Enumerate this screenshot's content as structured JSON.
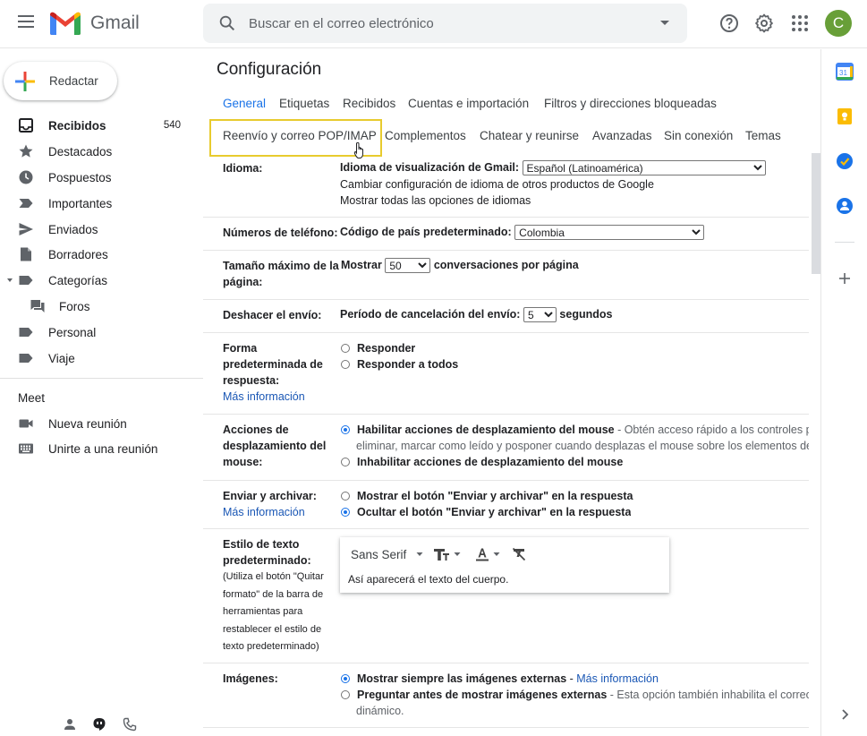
{
  "header": {
    "app_name": "Gmail",
    "search_placeholder": "Buscar en el correo electrónico",
    "avatar_letter": "C"
  },
  "sidebar": {
    "compose_label": "Redactar",
    "items": [
      {
        "label": "Recibidos",
        "count": "540",
        "icon": "inbox-icon"
      },
      {
        "label": "Destacados",
        "icon": "star-icon"
      },
      {
        "label": "Pospuestos",
        "icon": "clock-icon"
      },
      {
        "label": "Importantes",
        "icon": "label-important-icon"
      },
      {
        "label": "Enviados",
        "icon": "send-icon"
      },
      {
        "label": "Borradores",
        "icon": "draft-icon"
      },
      {
        "label": "Categorías",
        "icon": "label-icon"
      },
      {
        "label": "Foros",
        "icon": "forum-icon"
      },
      {
        "label": "Personal",
        "icon": "label-icon"
      },
      {
        "label": "Viaje",
        "icon": "label-icon"
      }
    ],
    "meet_title": "Meet",
    "meet_items": [
      {
        "label": "Nueva reunión",
        "icon": "video-icon"
      },
      {
        "label": "Unirte a una reunión",
        "icon": "keyboard-icon"
      }
    ]
  },
  "main": {
    "title": "Configuración",
    "tabs_row1": [
      "General",
      "Etiquetas",
      "Recibidos",
      "Cuentas e importación",
      "Filtros y direcciones bloqueadas"
    ],
    "tabs_row2": [
      "Reenvío y correo POP/IMAP",
      "Complementos",
      "Chatear y reunirse",
      "Avanzadas",
      "Sin conexión",
      "Temas"
    ],
    "settings": {
      "idioma": {
        "label": "Idioma:",
        "display_label": "Idioma de visualización de Gmail:",
        "display_value": "Español (Latinoamérica)",
        "link1": "Cambiar configuración de idioma de otros productos de Google",
        "link2": "Mostrar todas las opciones de idiomas"
      },
      "telefono": {
        "label": "Números de teléfono:",
        "code_label": "Código de país predeterminado:",
        "code_value": "Colombia"
      },
      "tamano": {
        "label_line1": "Tamaño máximo de la",
        "label_line2": "página:",
        "prefix": "Mostrar",
        "value": "50",
        "suffix": "conversaciones por página"
      },
      "deshacer": {
        "label": "Deshacer el envío:",
        "prefix": "Período de cancelación del envío:",
        "value": "5",
        "suffix": "segundos"
      },
      "respuesta": {
        "label_line1": "Forma",
        "label_line2": "predeterminada de",
        "label_line3": "respuesta:",
        "more": "Más información",
        "opt1": "Responder",
        "opt2": "Responder a todos"
      },
      "desplazamiento": {
        "label_line1": "Acciones de",
        "label_line2": "desplazamiento del",
        "label_line3": "mouse:",
        "opt1": "Habilitar acciones de desplazamiento del mouse",
        "opt1_desc_a": " - Obtén acceso rápido a los controles para archivar,",
        "opt1_desc_b": "eliminar, marcar como leído y posponer cuando desplazas el mouse sobre los elementos de la lista.",
        "opt2": "Inhabilitar acciones de desplazamiento del mouse"
      },
      "archivar": {
        "label": "Enviar y archivar:",
        "more": "Más información",
        "opt1": "Mostrar el botón \"Enviar y archivar\" en la respuesta",
        "opt2": "Ocultar el botón \"Enviar y archivar\" en la respuesta"
      },
      "estilo": {
        "label_line1": "Estilo de texto",
        "label_line2": "predeterminado:",
        "note1": "(Utiliza el botón \"Quitar",
        "note2": "formato\" de la barra de",
        "note3": "herramientas para",
        "note4": "restablecer el estilo de",
        "note5": "texto predeterminado)",
        "font": "Sans Serif",
        "sample": "Así aparecerá el texto del cuerpo."
      },
      "imagenes": {
        "label": "Imágenes:",
        "opt1": "Mostrar siempre las imágenes externas",
        "opt1_link": "Más información",
        "opt2": "Preguntar antes de mostrar imágenes externas",
        "opt2_desc_a": " - Esta opción también inhabilita el correo electrónico",
        "opt2_desc_b": "dinámico."
      }
    }
  },
  "colors": {
    "accent": "#1a73e8",
    "highlight": "#e8cb2e",
    "avatar": "#689f38"
  }
}
